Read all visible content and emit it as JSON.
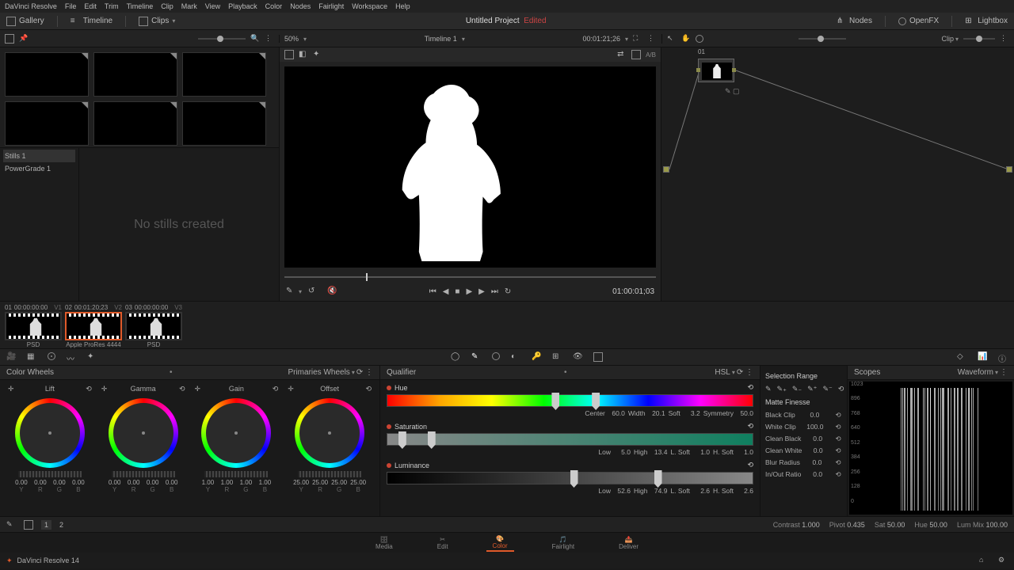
{
  "app_name": "DaVinci Resolve",
  "menus": [
    "File",
    "Edit",
    "Trim",
    "Timeline",
    "Clip",
    "Mark",
    "View",
    "Playback",
    "Color",
    "Nodes",
    "Fairlight",
    "Workspace",
    "Help"
  ],
  "toolbar": {
    "gallery": "Gallery",
    "timeline": "Timeline",
    "clips": "Clips",
    "nodes": "Nodes",
    "openfx": "OpenFX",
    "lightbox": "Lightbox"
  },
  "project": {
    "title": "Untitled Project",
    "edited": "Edited"
  },
  "subbar": {
    "zoom": "50%",
    "timeline_name": "Timeline 1",
    "source_tc": "00:01:21;26",
    "nodepanel": "Clip"
  },
  "stills": {
    "tab1": "Stills 1",
    "tab2": "PowerGrade 1",
    "empty": "No stills created"
  },
  "transport": {
    "tc": "01:00:01;03"
  },
  "node": {
    "label": "01"
  },
  "clips": [
    {
      "num": "01",
      "tc": "00:00:00:00",
      "track": "V1",
      "label": "PSD"
    },
    {
      "num": "02",
      "tc": "00:01:20;23",
      "track": "V2",
      "label": "Apple ProRes 4444",
      "selected": true
    },
    {
      "num": "03",
      "tc": "00:00:00:00",
      "track": "V3",
      "label": "PSD"
    }
  ],
  "wheels_panel": {
    "title": "Color Wheels",
    "mode": "Primaries Wheels",
    "wheels": [
      {
        "name": "Lift",
        "vals": [
          "0.00",
          "0.00",
          "0.00",
          "0.00"
        ]
      },
      {
        "name": "Gamma",
        "vals": [
          "0.00",
          "0.00",
          "0.00",
          "0.00"
        ]
      },
      {
        "name": "Gain",
        "vals": [
          "1.00",
          "1.00",
          "1.00",
          "1.00"
        ]
      },
      {
        "name": "Offset",
        "vals": [
          "25.00",
          "25.00",
          "25.00",
          "25.00"
        ]
      }
    ],
    "channels": [
      "Y",
      "R",
      "G",
      "B"
    ]
  },
  "qualifier": {
    "title": "Qualifier",
    "mode": "HSL",
    "hue": {
      "label": "Hue",
      "params": [
        [
          "Center",
          "60.0"
        ],
        [
          "Width",
          "20.1"
        ],
        [
          "Soft",
          "3.2"
        ],
        [
          "Symmetry",
          "50.0"
        ]
      ]
    },
    "sat": {
      "label": "Saturation",
      "params": [
        [
          "Low",
          "5.0"
        ],
        [
          "High",
          "13.4"
        ],
        [
          "L. Soft",
          "1.0"
        ],
        [
          "H. Soft",
          "1.0"
        ]
      ]
    },
    "lum": {
      "label": "Luminance",
      "params": [
        [
          "Low",
          "52.6"
        ],
        [
          "High",
          "74.9"
        ],
        [
          "L. Soft",
          "2.6"
        ],
        [
          "H. Soft",
          "2.6"
        ]
      ]
    }
  },
  "finesse": {
    "range": "Selection Range",
    "title": "Matte Finesse",
    "rows": [
      [
        "Black Clip",
        "0.0"
      ],
      [
        "White Clip",
        "100.0"
      ],
      [
        "Clean Black",
        "0.0"
      ],
      [
        "Clean White",
        "0.0"
      ],
      [
        "Blur Radius",
        "0.0"
      ],
      [
        "In/Out Ratio",
        "0.0"
      ]
    ]
  },
  "scopes": {
    "title": "Scopes",
    "mode": "Waveform",
    "ticks": [
      "1023",
      "896",
      "768",
      "640",
      "512",
      "384",
      "256",
      "128",
      "0"
    ]
  },
  "adjust": {
    "pages": [
      "1",
      "2"
    ],
    "params": [
      [
        "Contrast",
        "1.000"
      ],
      [
        "Pivot",
        "0.435"
      ],
      [
        "Sat",
        "50.00"
      ],
      [
        "Hue",
        "50.00"
      ],
      [
        "Lum Mix",
        "100.00"
      ]
    ]
  },
  "pages": [
    [
      "Media",
      false
    ],
    [
      "Edit",
      false
    ],
    [
      "Color",
      true
    ],
    [
      "Fairlight",
      false
    ],
    [
      "Deliver",
      false
    ]
  ],
  "footer": "DaVinci Resolve 14"
}
